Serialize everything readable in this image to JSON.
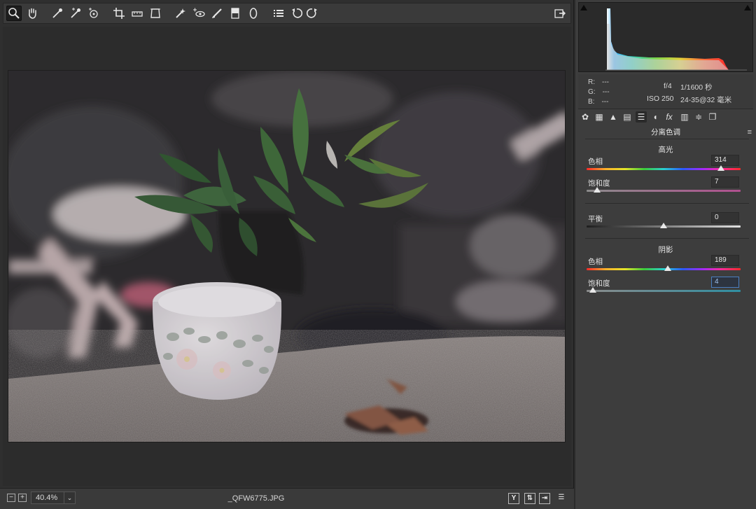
{
  "toolbar": {
    "tools": [
      "zoom-icon",
      "hand-icon",
      "white-balance-icon",
      "color-sampler-icon",
      "target-adjust-icon",
      "crop-icon",
      "straighten-icon",
      "transform-icon",
      "spot-removal-icon",
      "red-eye-icon",
      "adjustment-brush-icon",
      "graduated-filter-icon",
      "radial-filter-icon",
      "list-icon",
      "rotate-left-icon",
      "rotate-right-icon"
    ],
    "export_icon": "export-icon"
  },
  "status": {
    "zoom": "40.4%",
    "filename": "_QFW6775.JPG",
    "minus": "−",
    "plus": "+",
    "y_label": "Y"
  },
  "info": {
    "r_label": "R:",
    "r_value": "---",
    "g_label": "G:",
    "g_value": "---",
    "b_label": "B:",
    "b_value": "---",
    "aperture": "f/4",
    "shutter": "1/1600 秒",
    "iso": "ISO 250",
    "lens": "24-35@32 毫米"
  },
  "panel": {
    "title": "分离色调",
    "highlights": {
      "head": "高光",
      "hue_label": "色相",
      "hue_value": "314",
      "hue_fraction": 0.872,
      "sat_label": "饱和度",
      "sat_value": "7",
      "sat_fraction": 0.07
    },
    "balance": {
      "label": "平衡",
      "value": "0",
      "fraction": 0.5
    },
    "shadows": {
      "head": "阴影",
      "hue_label": "色相",
      "hue_value": "189",
      "hue_fraction": 0.525,
      "sat_label": "饱和度",
      "sat_value": "4",
      "sat_fraction": 0.04
    }
  }
}
